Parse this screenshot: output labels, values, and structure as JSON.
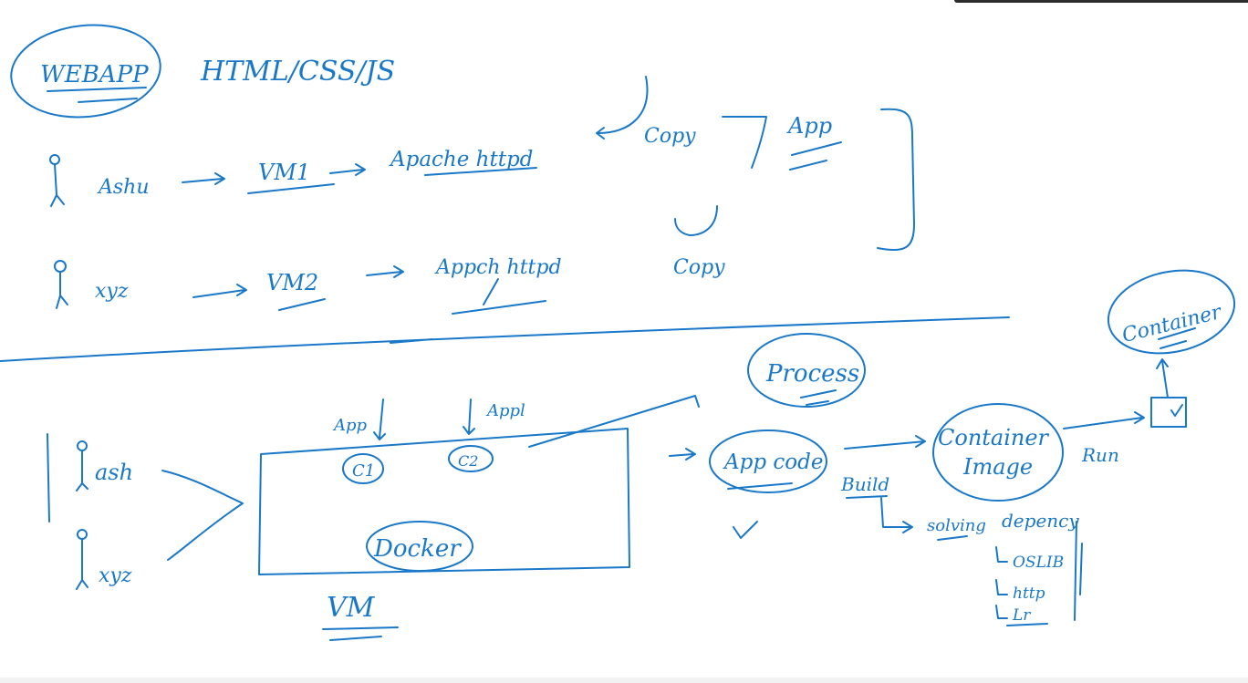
{
  "colors": {
    "ink": "#1a78c9",
    "background": "#ffffff"
  },
  "top": {
    "webapp": "WEBAPP",
    "tech": "HTML/CSS/JS",
    "user1": "Ashu",
    "vm1": "VM1",
    "apache1": "Apache httpd",
    "copy1": "Copy",
    "app_top": "App",
    "user2": "xyz",
    "vm2": "VM2",
    "apache2": "Appch httpd",
    "copy2": "Copy"
  },
  "bottom": {
    "user1": "ash",
    "user2": "xyz",
    "app1": "App",
    "app2": "Appl",
    "c1": "C1",
    "c2": "C2",
    "docker": "Docker",
    "vm": "VM",
    "process": "Process",
    "appcode": "App code",
    "build": "Build",
    "container_image_line1": "Container",
    "container_image_line2": "Image",
    "run": "Run",
    "container": "Container",
    "solving": "solving",
    "dependency": "depency",
    "dep1": "OSLIB",
    "dep2": "http",
    "dep3": "Lr"
  }
}
